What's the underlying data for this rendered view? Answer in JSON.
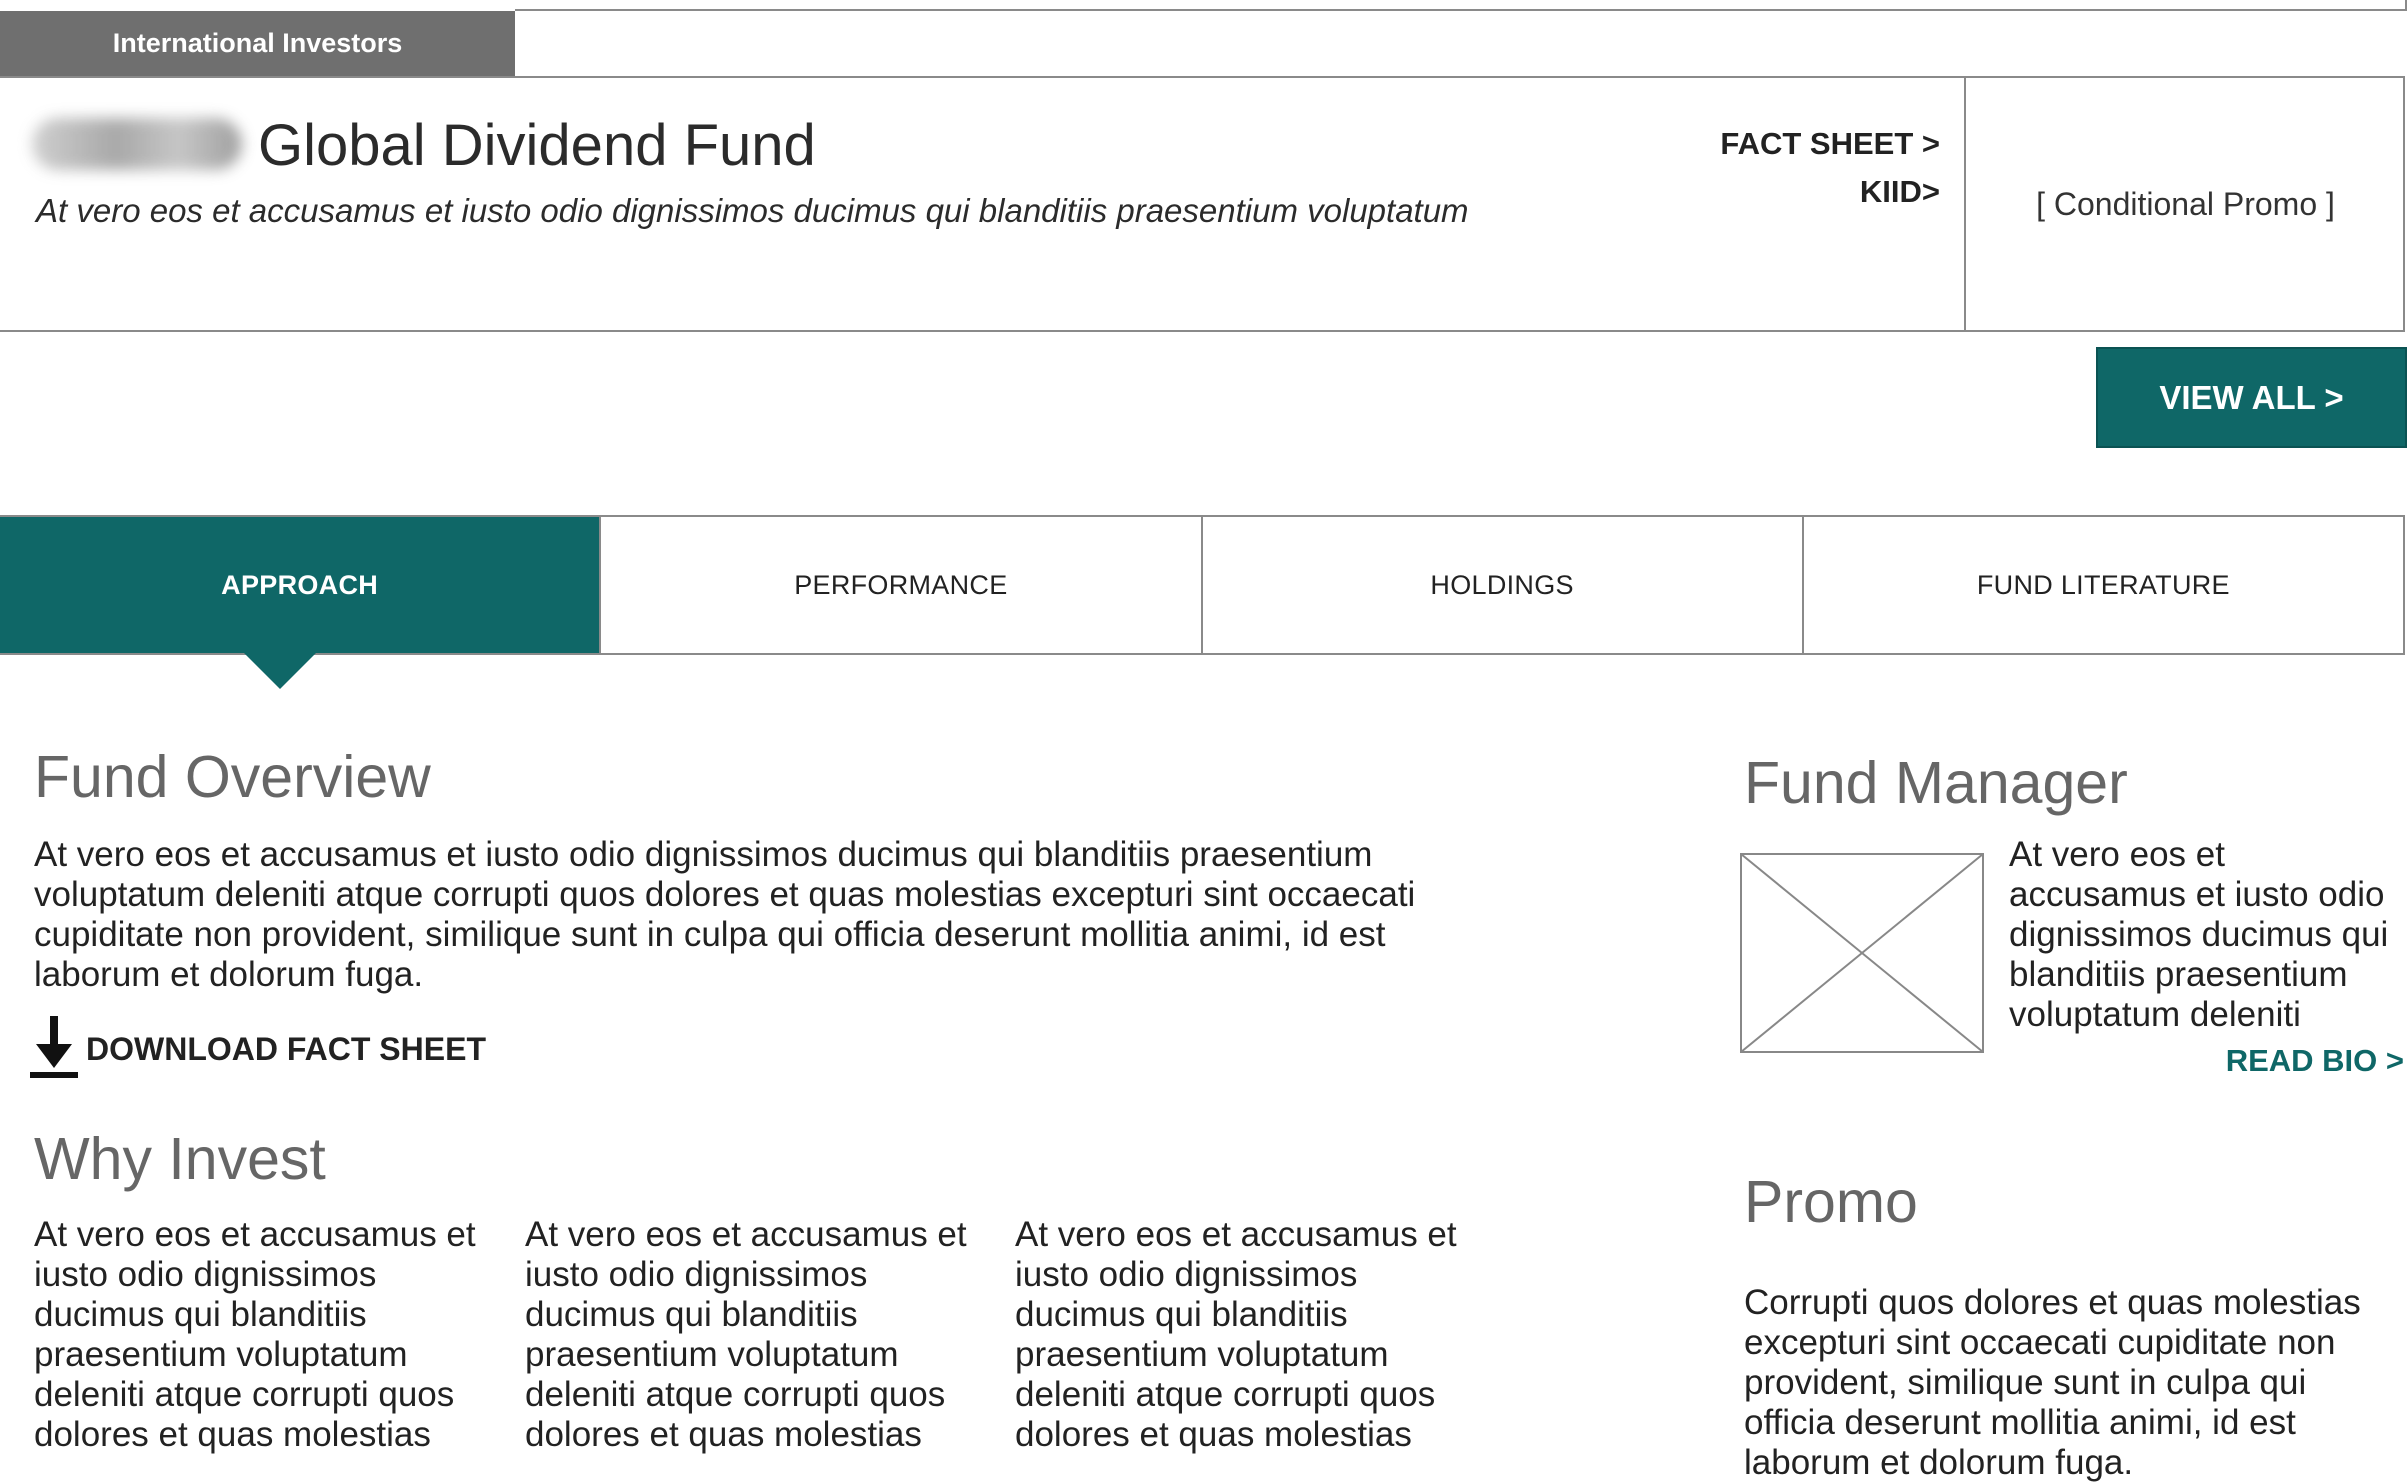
{
  "header": {
    "region_tab": "International Investors",
    "fund_title": "Global Dividend Fund",
    "fund_subtitle": "At vero eos et accusamus et iusto odio dignissimos ducimus qui blanditiis praesentium voluptatum",
    "fact_sheet_link": "FACT SHEET >",
    "kiid_link": "KIID>",
    "conditional_promo": "[ Conditional Promo ]",
    "view_all": "VIEW ALL >"
  },
  "tabs": [
    {
      "label": "APPROACH",
      "active": true
    },
    {
      "label": "PERFORMANCE",
      "active": false
    },
    {
      "label": "HOLDINGS",
      "active": false
    },
    {
      "label": "FUND LITERATURE",
      "active": false
    }
  ],
  "overview": {
    "title": "Fund Overview",
    "body": "At vero eos et accusamus et iusto odio dignissimos ducimus qui blanditiis praesentium voluptatum deleniti atque corrupti quos dolores et quas molestias excepturi sint occaecati cupiditate non provident, similique sunt in culpa qui officia deserunt mollitia animi, id est laborum et dolorum fuga.",
    "download_label": "DOWNLOAD FACT SHEET"
  },
  "why_invest": {
    "title": "Why Invest",
    "columns": [
      "At vero eos et accusamus et iusto odio dignissimos ducimus qui blanditiis praesentium voluptatum deleniti atque corrupti quos dolores et quas molestias",
      "At vero eos et accusamus et iusto odio dignissimos ducimus qui blanditiis praesentium voluptatum deleniti atque corrupti quos dolores et quas molestias",
      "At vero eos et accusamus et iusto odio dignissimos ducimus qui blanditiis praesentium voluptatum deleniti atque corrupti quos dolores et quas molestias"
    ]
  },
  "fund_manager": {
    "title": "Fund Manager",
    "bio": "At vero eos et accusamus et iusto odio dignissimos ducimus qui blanditiis praesentium voluptatum deleniti",
    "read_bio": "READ BIO >"
  },
  "promo": {
    "title": "Promo",
    "body": "Corrupti quos dolores et quas molestias excepturi sint occaecati cupiditate non provident, similique sunt in culpa qui officia deserunt mollitia animi, id est laborum et dolorum fuga."
  },
  "icons": {
    "download": "download-icon",
    "placeholder_image": "image-placeholder-icon",
    "logo": "fund-logo"
  },
  "colors": {
    "accent": "#0f6767",
    "region_tab_bg": "#6f6f6f",
    "heading_gray": "#666666"
  }
}
